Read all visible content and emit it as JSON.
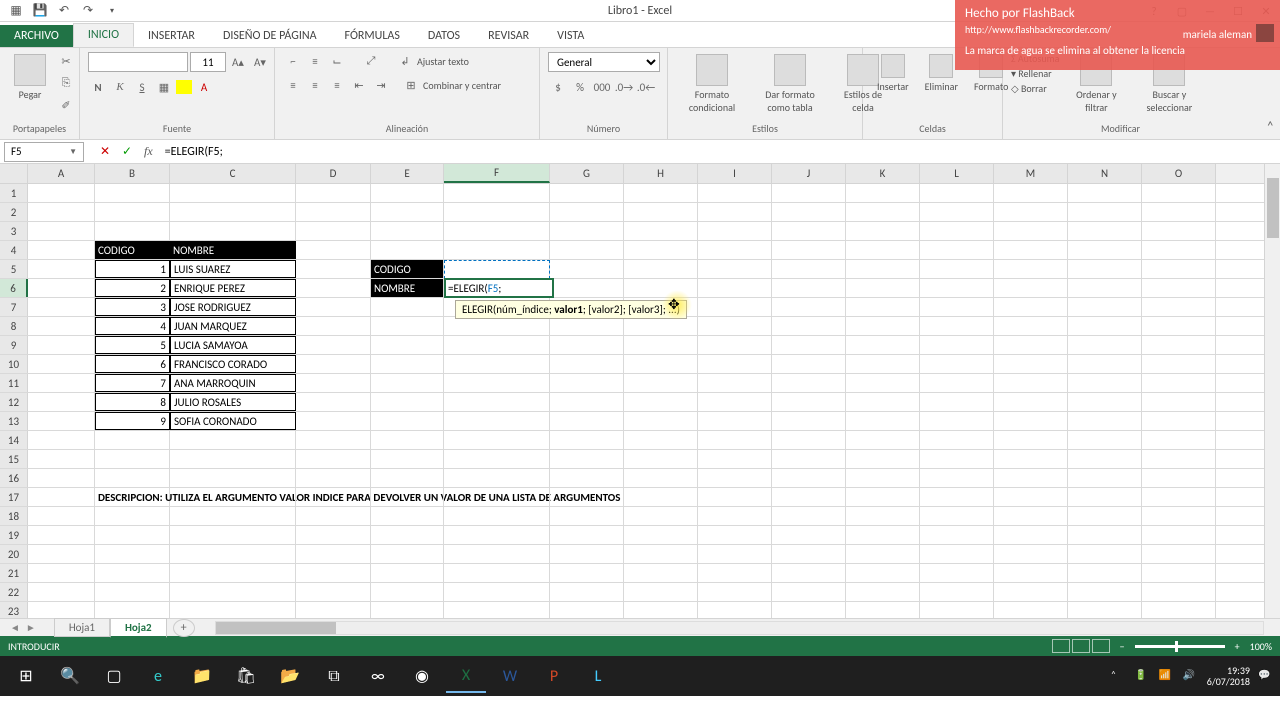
{
  "titlebar": {
    "title": "Libro1 - Excel"
  },
  "flashback": {
    "title": "Hecho por FlashBack",
    "url": "http://www.flashbackrecorder.com/",
    "message": "La marca de agua se elimina al obtener la licencia",
    "user": "mariela aleman"
  },
  "tabs": {
    "file": "ARCHIVO",
    "items": [
      "INICIO",
      "INSERTAR",
      "DISEÑO DE PÁGINA",
      "FÓRMULAS",
      "DATOS",
      "REVISAR",
      "VISTA"
    ],
    "active": "INICIO"
  },
  "ribbon": {
    "portapapeles": {
      "label": "Portapapeles",
      "paste": "Pegar"
    },
    "fuente": {
      "label": "Fuente",
      "size": "11"
    },
    "alineacion": {
      "label": "Alineación",
      "wrap": "Ajustar texto",
      "merge": "Combinar y centrar"
    },
    "numero": {
      "label": "Número",
      "format": "General"
    },
    "estilos": {
      "label": "Estilos",
      "cond": "Formato condicional",
      "table": "Dar formato como tabla",
      "cell": "Estilos de celda"
    },
    "celdas": {
      "label": "Celdas",
      "insert": "Insertar",
      "delete": "Eliminar",
      "format": "Formato"
    },
    "modificar": {
      "label": "Modificar",
      "autosum": "Autosuma",
      "fill": "Rellenar",
      "clear": "Borrar",
      "sort": "Ordenar y filtrar",
      "find": "Buscar y seleccionar"
    }
  },
  "formulaBar": {
    "nameBox": "F5",
    "formula": "=ELEGIR(F5;",
    "formula_prefix": "=ELEGIR(",
    "formula_ref": "F5",
    "formula_suffix": ";"
  },
  "columns": [
    "A",
    "B",
    "C",
    "D",
    "E",
    "F",
    "G",
    "H",
    "I",
    "J",
    "K",
    "L",
    "M",
    "N",
    "O"
  ],
  "table1": {
    "headers": {
      "codigo": "CODIGO",
      "nombre": "NOMBRE"
    },
    "rows": [
      {
        "codigo": "1",
        "nombre": "LUIS SUAREZ"
      },
      {
        "codigo": "2",
        "nombre": "ENRIQUE PEREZ"
      },
      {
        "codigo": "3",
        "nombre": "JOSE RODRIGUEZ"
      },
      {
        "codigo": "4",
        "nombre": "JUAN MARQUEZ"
      },
      {
        "codigo": "5",
        "nombre": "LUCIA SAMAYOA"
      },
      {
        "codigo": "6",
        "nombre": "FRANCISCO CORADO"
      },
      {
        "codigo": "7",
        "nombre": "ANA MARROQUIN"
      },
      {
        "codigo": "8",
        "nombre": "JULIO ROSALES"
      },
      {
        "codigo": "9",
        "nombre": "SOFIA CORONADO"
      }
    ]
  },
  "lookup": {
    "codigo": "CODIGO",
    "nombre": "NOMBRE"
  },
  "editCell": {
    "prefix": "=ELEGIR(",
    "ref": "F5",
    "suffix": ";"
  },
  "tooltip": {
    "func": "ELEGIR(",
    "arg1": "núm_índice",
    "arg2": "valor1",
    "arg3": "[valor2]",
    "arg4": "[valor3]",
    "sep": "; ",
    "end": "; ...)"
  },
  "description": "DESCRIPCION: UTILIZA EL ARGUMENTO VALOR INDICE PARA DEVOLVER UN VALOR DE UNA LISTA DE ARGUMENTOS",
  "sheets": {
    "tabs": [
      "Hoja1",
      "Hoja2"
    ],
    "active": "Hoja2"
  },
  "status": {
    "mode": "INTRODUCIR",
    "zoom": "100%"
  },
  "taskbar": {
    "time": "19:39",
    "date": "6/07/2018"
  }
}
